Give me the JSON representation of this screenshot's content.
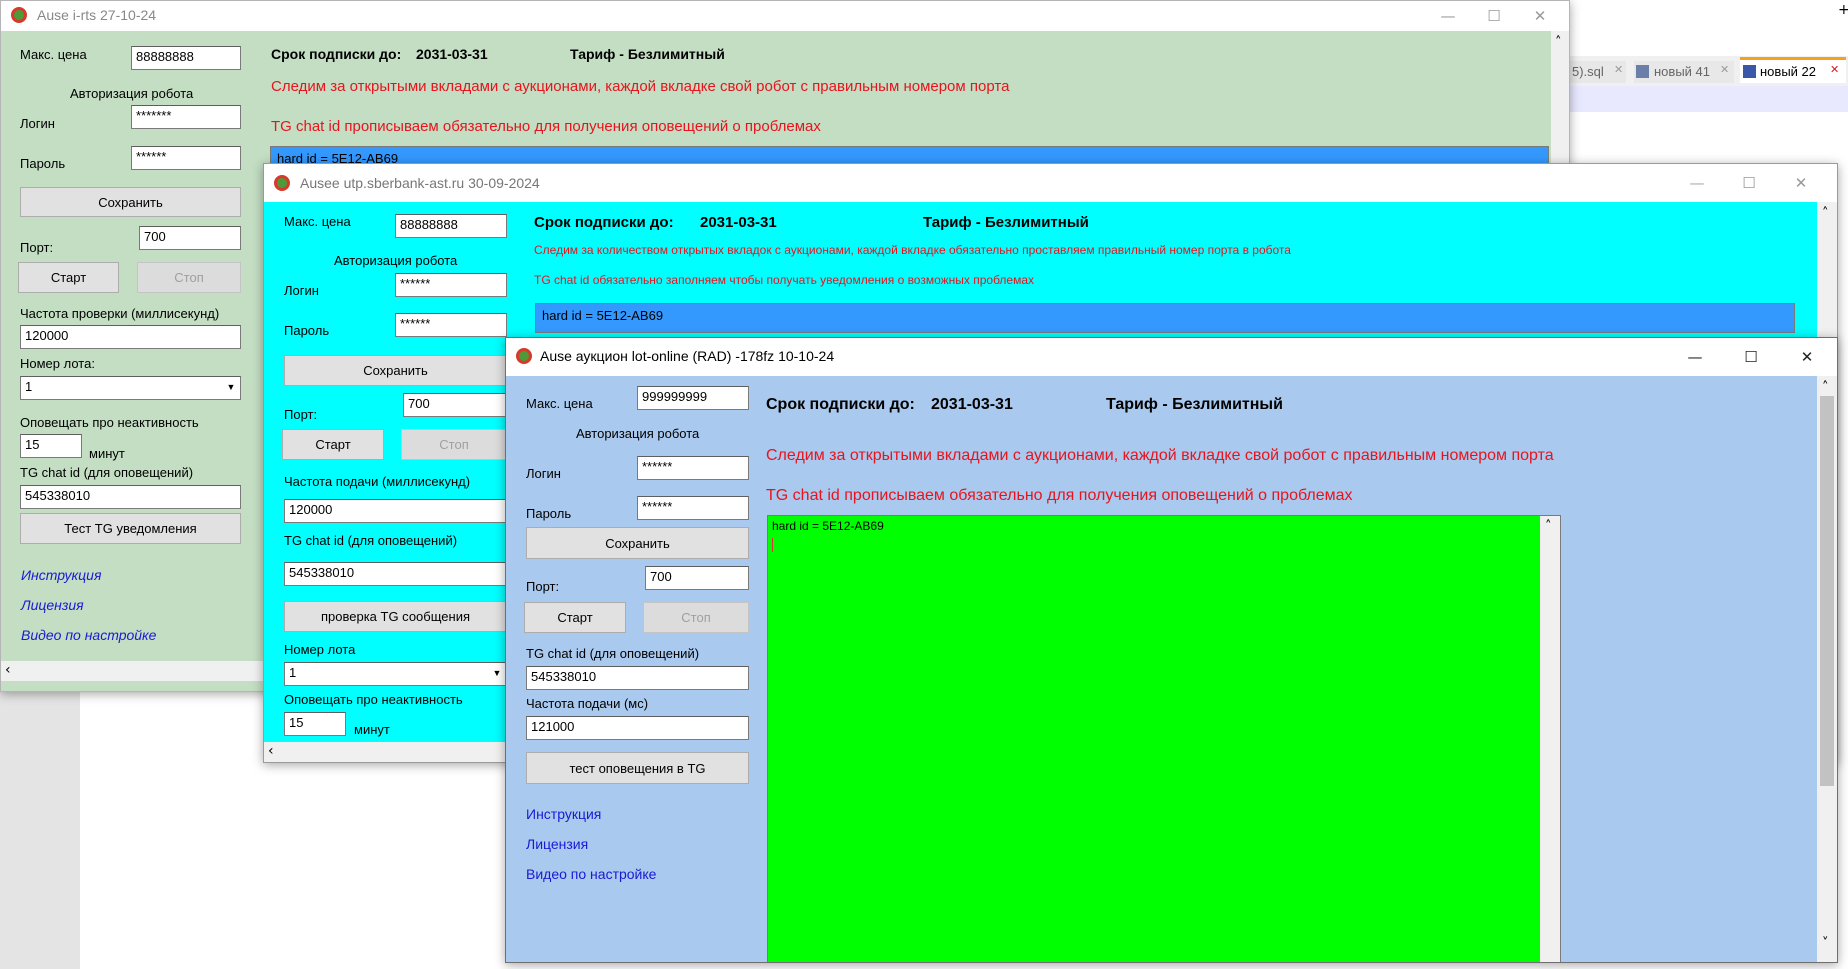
{
  "background_app": {
    "tabs": [
      {
        "label": "5).sql"
      },
      {
        "label": "новый 41"
      },
      {
        "label": "новый 22"
      }
    ],
    "plus": "+"
  },
  "window1": {
    "title": "Ause i-rts  27-10-24",
    "bg": "#c3dec3",
    "max_price_label": "Макс. цена",
    "max_price_value": "88888888",
    "auth_heading": "Авторизация робота",
    "login_label": "Логин",
    "login_value": "*******",
    "password_label": "Пароль",
    "password_value": "******",
    "save_label": "Сохранить",
    "port_label": "Порт:",
    "port_value": "700",
    "start_label": "Старт",
    "stop_label": "Стоп",
    "check_freq_label": "Частота проверки (миллисекунд)",
    "check_freq_value": "120000",
    "lot_number_label": "Номер лота:",
    "lot_number_value": "1",
    "inactivity_label": "Оповещать про неактивность",
    "inactivity_value": "15",
    "minutes_label": "минут",
    "tg_chat_label": "TG chat id (для оповещений)",
    "tg_chat_value": "545338010",
    "test_tg_label": "Тест TG уведомления",
    "links": [
      "Инструкция",
      "Лицензия",
      "Видео по настройке"
    ],
    "subscription_label": "Срок подписки до:",
    "subscription_date": "2031-03-31",
    "tariff": "Тариф - Безлимитный",
    "info1": "Следим за открытыми вкладами с аукционами, каждой вкладке свой робот с правильным номером порта",
    "info2": "TG chat id  прописываем обязательно для получения оповещений о проблемах",
    "log_text": "hard id = 5E12-AB69"
  },
  "window2": {
    "title": "Ausee utp.sberbank-ast.ru 30-09-2024",
    "bg": "#00ffff",
    "max_price_label": "Макс. цена",
    "max_price_value": "88888888",
    "auth_heading": "Авторизация робота",
    "login_label": "Логин",
    "login_value": "******",
    "password_label": "Пароль",
    "password_value": "******",
    "save_label": "Сохранить",
    "port_label": "Порт:",
    "port_value": "700",
    "start_label": "Старт",
    "stop_label": "Стоп",
    "freq_label": "Частота подачи (миллисекунд)",
    "freq_value": "120000",
    "tg_chat_label": "TG chat id (для оповещений)",
    "tg_chat_value": "545338010",
    "check_tg_label": "проверка TG сообщения",
    "lot_number_label": "Номер лота",
    "lot_number_value": "1",
    "inactivity_label": "Оповещать про неактивность",
    "inactivity_value": "15",
    "minutes_label": "минут",
    "subscription_label": "Срок подписки до:",
    "subscription_date": "2031-03-31",
    "tariff": "Тариф - Безлимитный",
    "info1": "Следим за количеством открытых вкладок с аукционами, каждой вкладке обязательно проставляем правильный номер порта в робота",
    "info2": "TG chat id обязательно заполняем чтобы получать уведомления о возможных проблемах",
    "log_text": "hard id = 5E12-AB69"
  },
  "window3": {
    "title": "Ause аукцион lot-online (RAD) -178fz 10-10-24",
    "bg": "#a9c9ee",
    "log_bg": "#00ff00",
    "max_price_label": "Макс. цена",
    "max_price_value": "999999999",
    "auth_heading": "Авторизация робота",
    "login_label": "Логин",
    "login_value": "******",
    "password_label": "Пароль",
    "password_value": "******",
    "save_label": "Сохранить",
    "port_label": "Порт:",
    "port_value": "700",
    "start_label": "Старт",
    "stop_label": "Стоп",
    "tg_chat_label": "TG chat id (для оповещений)",
    "tg_chat_value": "545338010",
    "freq_label": "Частота подачи (мс)",
    "freq_value": "121000",
    "test_tg_label": "тест оповещения в TG",
    "links": [
      "Инструкция",
      "Лицензия",
      "Видео по настройке"
    ],
    "subscription_label": "Срок подписки до:",
    "subscription_date": "2031-03-31",
    "tariff": "Тариф - Безлимитный",
    "info1": "Следим за открытыми вкладами с аукционами, каждой вкладке свой робот с правильным номером порта",
    "info2": "TG chat id  прописываем обязательно для получения оповещений о проблемах",
    "log_text": "hard id = 5E12-AB69"
  },
  "icons": {
    "minimize": "—",
    "maximize": "☐",
    "close": "✕",
    "combo_arrow": "▼",
    "scroll_up": "˄",
    "scroll_down": "˅",
    "scroll_left": "‹"
  }
}
